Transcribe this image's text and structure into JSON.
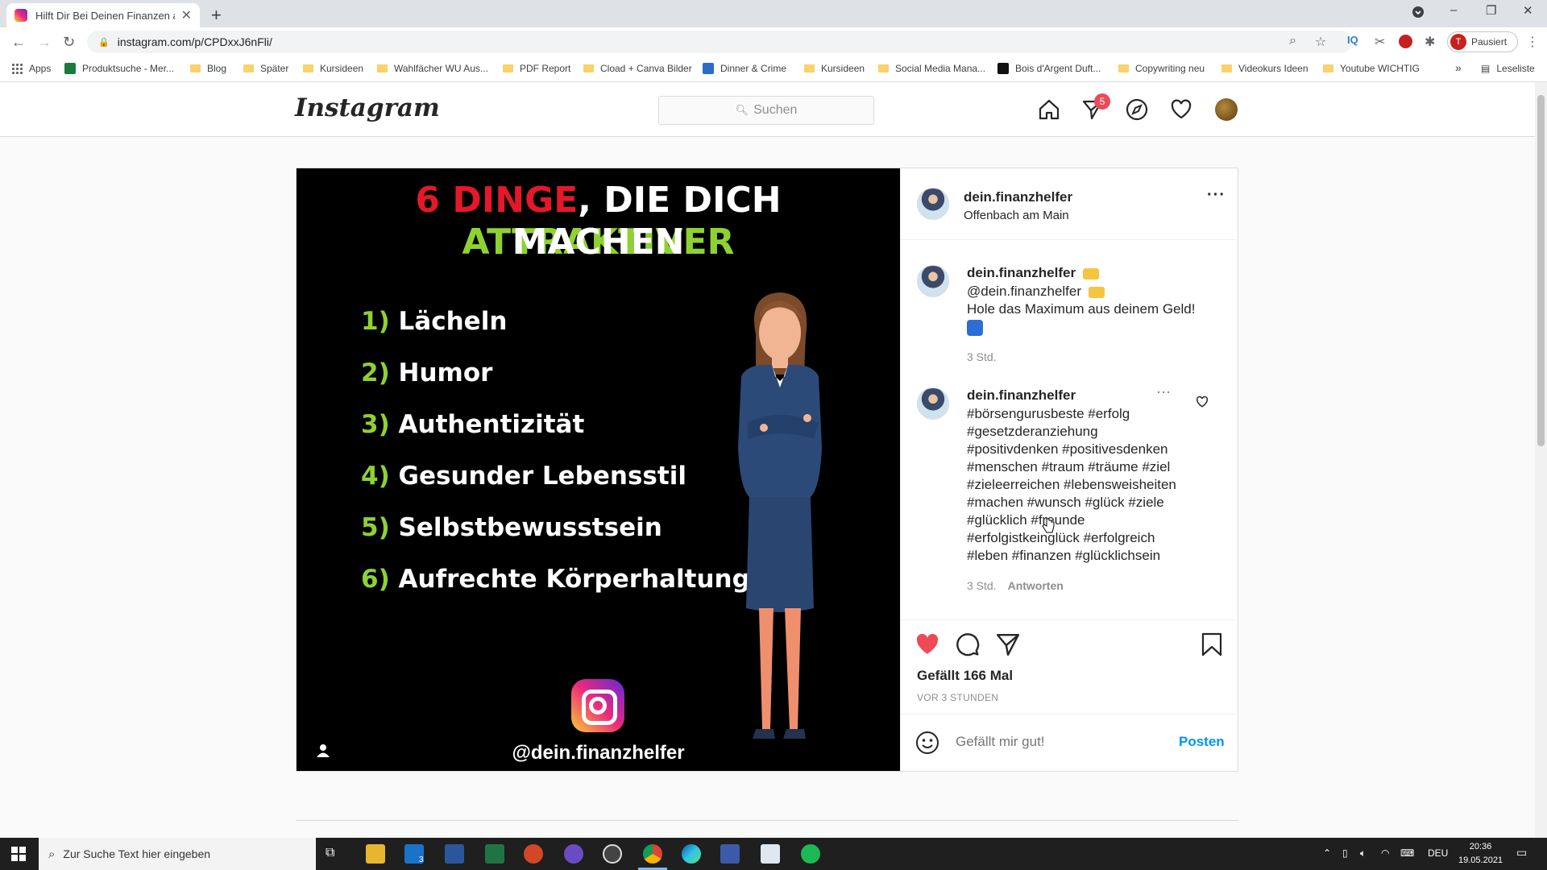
{
  "browser": {
    "tab_title": "Hilft Dir Bei Deinen Finanzen auf",
    "url": "instagram.com/p/CPDxxJ6nFli/",
    "profile_label": "Pausiert",
    "profile_initial": "T",
    "bookmarks": [
      {
        "label": "Apps"
      },
      {
        "label": "Produktsuche - Mer..."
      },
      {
        "label": "Blog"
      },
      {
        "label": "Später"
      },
      {
        "label": "Kursideen"
      },
      {
        "label": "Wahlfächer WU Aus..."
      },
      {
        "label": "PDF Report"
      },
      {
        "label": "Cload + Canva Bilder"
      },
      {
        "label": "Dinner & Crime"
      },
      {
        "label": "Kursideen"
      },
      {
        "label": "Social Media Mana..."
      },
      {
        "label": "Bois d'Argent Duft..."
      },
      {
        "label": "Copywriting neu"
      },
      {
        "label": "Videokurs Ideen"
      },
      {
        "label": "Youtube WICHTIG"
      }
    ],
    "reading_list": "Leseliste",
    "more_bookmarks": "»"
  },
  "instagram": {
    "logo": "Instagram",
    "search_placeholder": "Suchen",
    "direct_badge": "5",
    "post": {
      "image": {
        "title_red": "6 DINGE",
        "title_white1": ", DIE DICH ",
        "title_green": "ATTRAKTIVER",
        "title_line2": "MACHEN",
        "items": [
          {
            "num": "1)",
            "text": "Lächeln"
          },
          {
            "num": "2)",
            "text": "Humor"
          },
          {
            "num": "3)",
            "text": "Authentizität"
          },
          {
            "num": "4)",
            "text": "Gesunder Lebensstil"
          },
          {
            "num": "5)",
            "text": "Selbstbewusstsein"
          },
          {
            "num": "6)",
            "text": "Aufrechte Körperhaltung"
          }
        ],
        "handle": "@dein.finanzhelfer"
      },
      "author": "dein.finanzhelfer",
      "location": "Offenbach am Main",
      "caption": {
        "username": "dein.finanzhelfer",
        "line1": "@dein.finanzhelfer",
        "line2": "Hole das Maximum aus deinem Geld!",
        "time": "3 Std."
      },
      "comment": {
        "username": "dein.finanzhelfer",
        "lines": [
          "#börsengurusbeste #erfolg",
          "#gesetzderanziehung",
          "#positivdenken #positivesdenken",
          "#menschen #traum #träume #ziel",
          "#zieleerreichen #lebensweisheiten",
          "#machen #wunsch #glück #ziele",
          "#glücklich #freunde",
          "#erfolgistkeinglück #erfolgreich",
          "#leben #finanzen #glücklichsein"
        ],
        "time": "3 Std.",
        "reply": "Antworten"
      },
      "likes": "Gefällt 166 Mal",
      "ago": "VOR 3 STUNDEN",
      "comment_placeholder": "Gefällt mir gut!",
      "post_button": "Posten"
    }
  },
  "taskbar": {
    "search_placeholder": "Zur Suche Text hier eingeben",
    "mail_badge": "3",
    "language": "DEU",
    "time": "20:36",
    "date": "19.05.2021"
  },
  "colors": {
    "ig_blue": "#0095f6",
    "like_red": "#ed4956",
    "image_red": "#e4182a",
    "image_green": "#8ed232"
  }
}
